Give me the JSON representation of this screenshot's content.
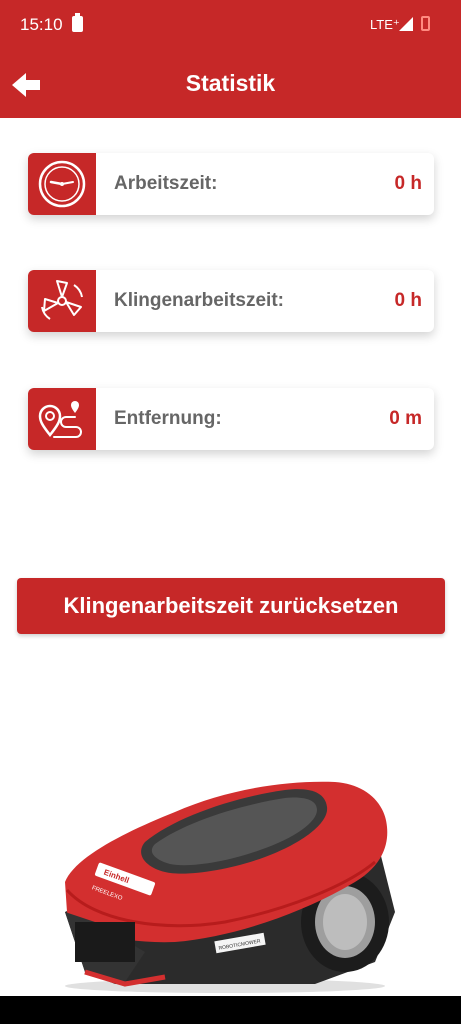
{
  "status_bar": {
    "time": "15:10",
    "network": "LTE⁺"
  },
  "app_bar": {
    "title": "Statistik"
  },
  "stats": [
    {
      "label": "Arbeitszeit:",
      "value": "0 h",
      "icon": "clock-icon"
    },
    {
      "label": "Klingenarbeitszeit:",
      "value": "0 h",
      "icon": "blade-icon"
    },
    {
      "label": "Entfernung:",
      "value": "0 m",
      "icon": "route-icon"
    }
  ],
  "actions": {
    "reset_label": "Klingenarbeitszeit zurücksetzen"
  },
  "product_image": {
    "logo": "Einhell",
    "model": "FREELEXO",
    "subtext": "ROBOTICMOWER"
  },
  "colors": {
    "primary": "#c62828",
    "label": "#666666",
    "background": "#ffffff"
  }
}
